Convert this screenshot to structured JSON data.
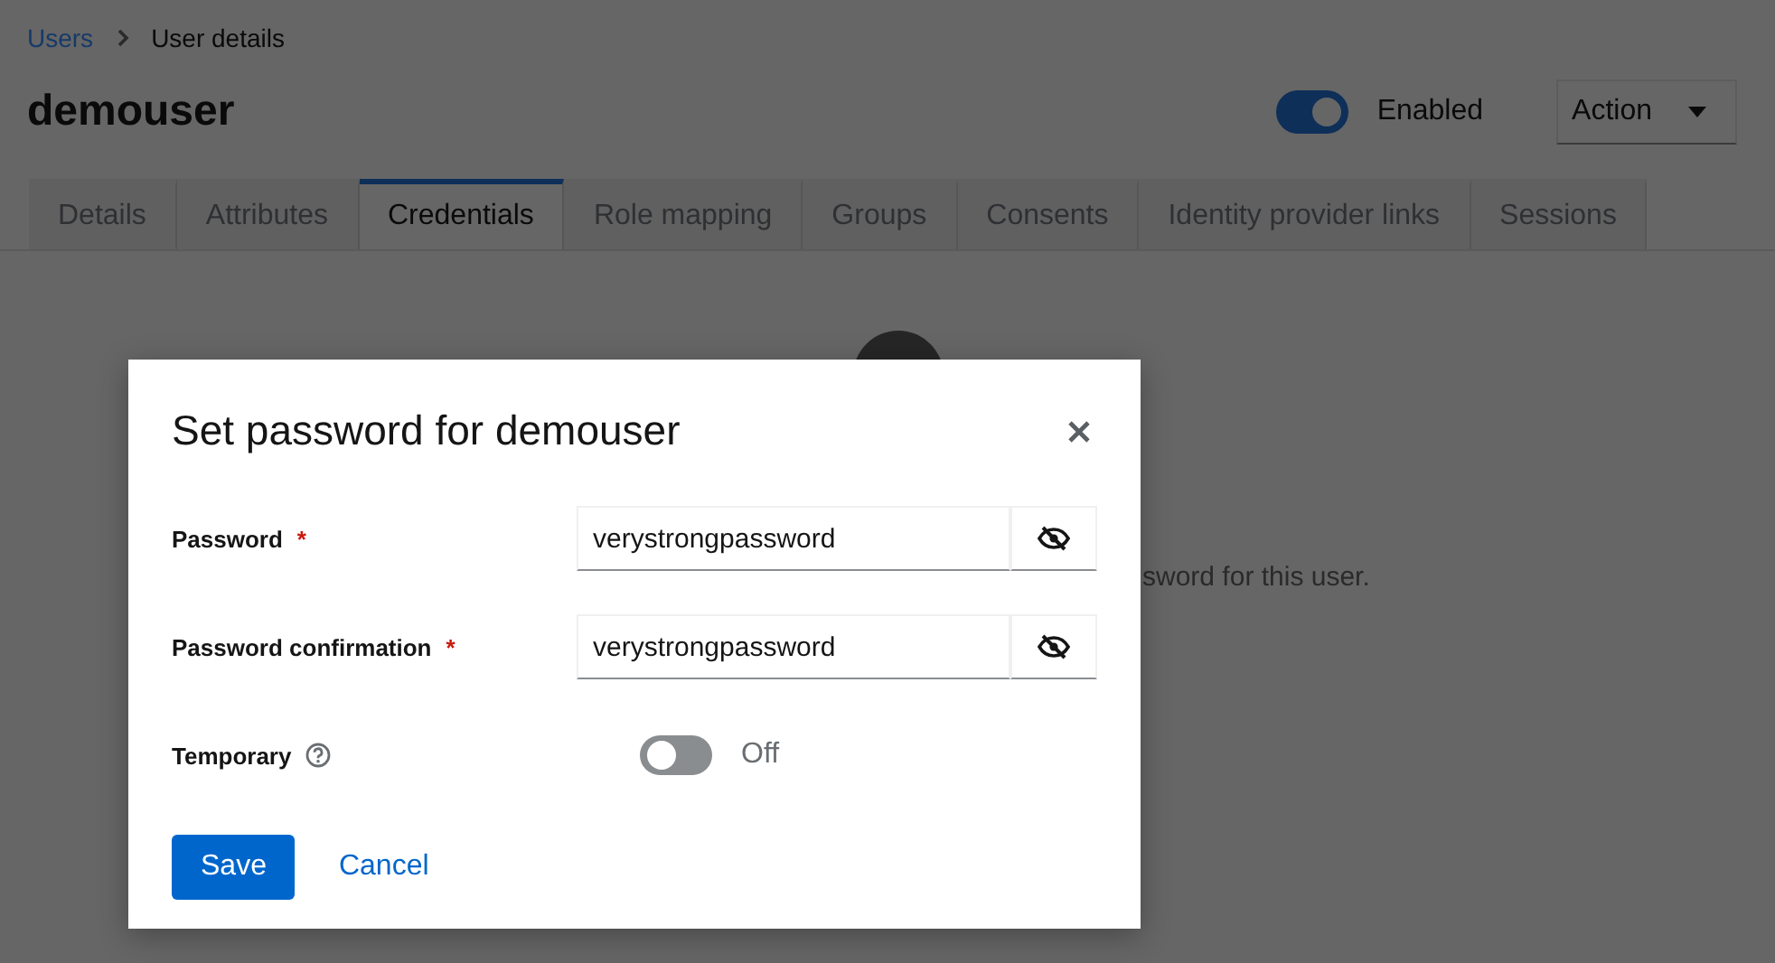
{
  "breadcrumb": [
    {
      "label": "Users",
      "kind": "link"
    },
    {
      "label": "User details",
      "kind": "current"
    }
  ],
  "title": "demouser",
  "enabled_switch": {
    "label": "Enabled",
    "on": true
  },
  "action_menu": {
    "label": "Action"
  },
  "tabs": [
    {
      "label": "Details",
      "selected": false
    },
    {
      "label": "Attributes",
      "selected": false
    },
    {
      "label": "Credentials",
      "selected": true
    },
    {
      "label": "Role mapping",
      "selected": false
    },
    {
      "label": "Groups",
      "selected": false
    },
    {
      "label": "Consents",
      "selected": false
    },
    {
      "label": "Identity provider links",
      "selected": false
    },
    {
      "label": "Sessions",
      "selected": false
    }
  ],
  "background_text": "sword for this user.",
  "modal": {
    "title": "Set password for demouser",
    "fields": [
      {
        "kind": "password",
        "label": "Password",
        "required_mark": "*",
        "value": "verystrongpassword"
      },
      {
        "kind": "password",
        "label": "Password confirmation",
        "required_mark": "*",
        "value": "verystrongpassword"
      },
      {
        "kind": "switch",
        "label": "Temporary",
        "help": true,
        "on": false,
        "state_label": "Off"
      }
    ],
    "buttons": [
      {
        "kind": "primary",
        "label": "Save"
      },
      {
        "kind": "link",
        "label": "Cancel"
      }
    ]
  }
}
